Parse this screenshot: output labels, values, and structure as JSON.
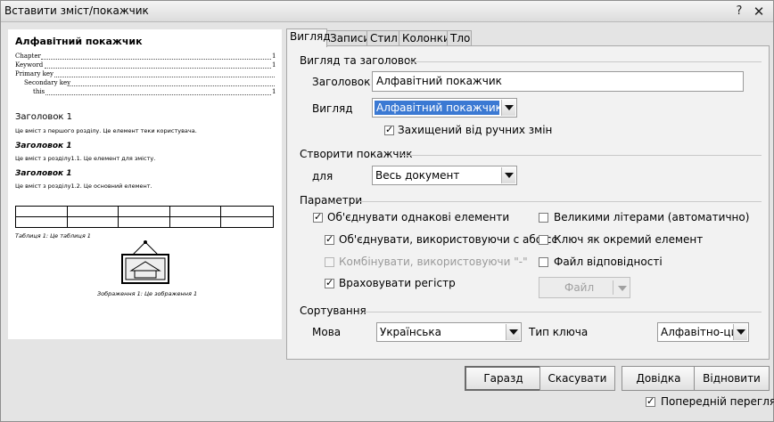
{
  "window": {
    "title": "Вставити зміст/покажчик"
  },
  "preview": {
    "index_title": "Алфавітний покажчик",
    "entries": [
      {
        "text": "Chapter",
        "page": "1"
      },
      {
        "text": "Keyword",
        "page": "1"
      },
      {
        "text": "Primary key",
        "page": ""
      },
      {
        "text": "Secondary key",
        "page": ""
      },
      {
        "text": "this",
        "page": "1"
      }
    ],
    "heading1": "Заголовок 1",
    "text1": "Це вміст з першого розділу. Це елемент теки користувача.",
    "heading2": "Заголовок 1",
    "text2": "Це вміст з розділу1.1. Це елемент для змісту.",
    "heading3": "Заголовок 1",
    "text3": "Це вміст з розділу1.2. Це основний елемент.",
    "table_caption": "Таблиця 1: Це таблиця 1",
    "image_caption": "Зображення 1: Це зображення 1"
  },
  "tabs": [
    "Вигляд",
    "Записи",
    "Стилі",
    "Колонки",
    "Тло"
  ],
  "view_section": {
    "title": "Вигляд та заголовок",
    "heading_label": "Заголовок",
    "heading_value": "Алфавітний покажчик",
    "type_label": "Вигляд",
    "type_value": "Алфавітний покажчик",
    "protected_label": "Захищений від ручних змін"
  },
  "create_section": {
    "title": "Створити покажчик",
    "for_label": "для",
    "for_value": "Весь документ"
  },
  "options": {
    "title": "Параметри",
    "combine_identical": "Об'єднувати однакові елементи",
    "combine_with_ff": "Об'єднувати, використовуючи с або сс",
    "combine_with_dash": "Комбінувати, використовуючи \"-\"",
    "case_sensitive": "Враховувати регістр",
    "autocapitalize": "Великими літерами (автоматично)",
    "keys_separate": "Ключ як окремий елемент",
    "concordance": "Файл відповідності",
    "file_button": "Файл"
  },
  "sort": {
    "title": "Сортування",
    "language_label": "Мова",
    "language_value": "Українська",
    "key_type_label": "Тип ключа",
    "key_type_value": "Алфавітно-циф"
  },
  "buttons": {
    "ok": "Гаразд",
    "cancel": "Скасувати",
    "help": "Довідка",
    "reset": "Відновити"
  },
  "preview_checkbox": "Попередній перегляд"
}
